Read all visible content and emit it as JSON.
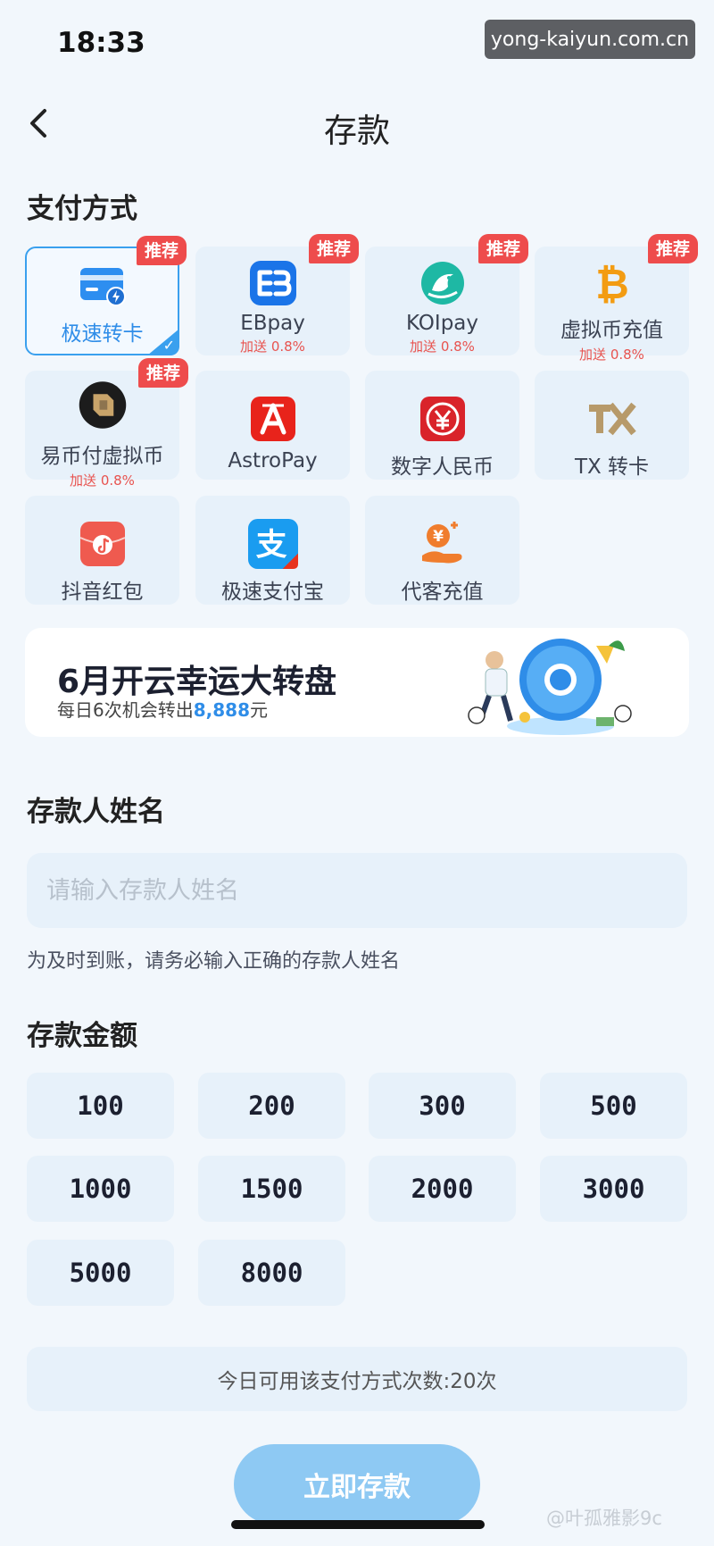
{
  "status_bar": {
    "time": "18:33"
  },
  "watermark": "yong-kaiyun.com.cn",
  "header": {
    "title": "存款"
  },
  "payment": {
    "section_label": "支付方式",
    "methods": [
      {
        "label": "极速转卡",
        "badge": "推荐",
        "selected": true,
        "icon": "card-lightning-icon"
      },
      {
        "label": "EBpay",
        "bonus": "加送 0.8%",
        "badge": "推荐",
        "icon": "ebpay-icon"
      },
      {
        "label": "KOIpay",
        "bonus": "加送 0.8%",
        "badge": "推荐",
        "icon": "koi-fish-icon"
      },
      {
        "label": "虚拟币充值",
        "bonus": "加送 0.8%",
        "badge": "推荐",
        "icon": "bitcoin-icon"
      },
      {
        "label": "易币付虚拟币",
        "bonus": "加送 0.8%",
        "badge": "推荐",
        "icon": "yibifu-icon"
      },
      {
        "label": "AstroPay",
        "icon": "astropay-icon"
      },
      {
        "label": "数字人民币",
        "icon": "digital-rmb-icon"
      },
      {
        "label": "TX 转卡",
        "icon": "tx-logo-icon"
      },
      {
        "label": "抖音红包",
        "icon": "douyin-red-packet-icon"
      },
      {
        "label": "极速支付宝",
        "icon": "alipay-icon"
      },
      {
        "label": "代客充值",
        "icon": "hand-coin-icon"
      }
    ]
  },
  "banner": {
    "title": "6月开云幸运大转盘",
    "subtitle_prefix": "每日6次机会转出",
    "subtitle_amount": "8,888",
    "subtitle_suffix": "元"
  },
  "depositor": {
    "section_label": "存款人姓名",
    "placeholder": "请输入存款人姓名",
    "hint": "为及时到账，请务必输入正确的存款人姓名"
  },
  "amount": {
    "section_label": "存款金额",
    "options": [
      "100",
      "200",
      "300",
      "500",
      "1000",
      "1500",
      "2000",
      "3000",
      "5000",
      "8000"
    ]
  },
  "limit_text": "今日可用该支付方式次数:20次",
  "submit_label": "立即存款",
  "footer_watermark": "@叶孤雅影9c",
  "colors": {
    "accent": "#3aa0ee",
    "badge": "#ee4c4c",
    "tile_bg": "#e7f1fa",
    "button": "#8ec9f3"
  }
}
